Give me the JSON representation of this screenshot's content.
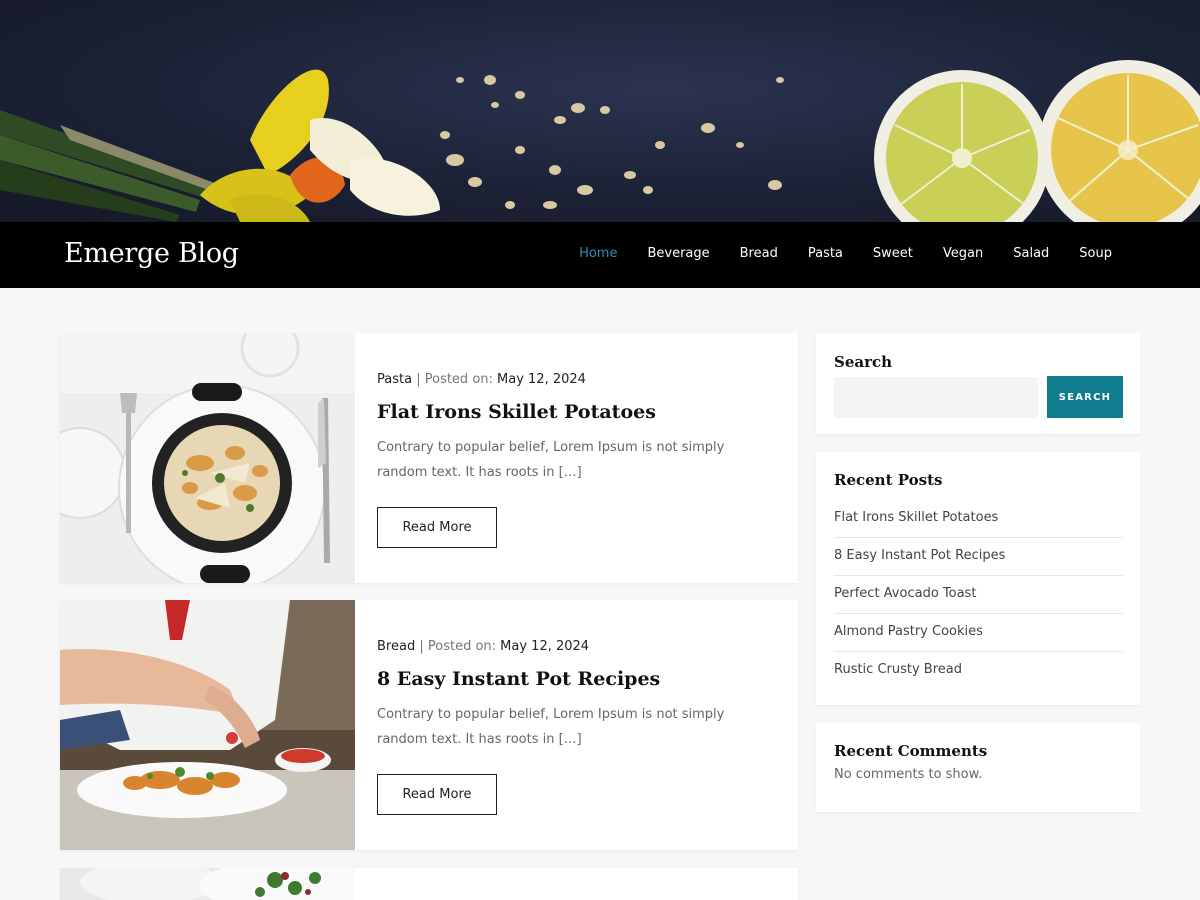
{
  "site": {
    "title": "Emerge Blog"
  },
  "nav": {
    "items": [
      {
        "label": "Home",
        "active": true
      },
      {
        "label": "Beverage",
        "active": false
      },
      {
        "label": "Bread",
        "active": false
      },
      {
        "label": "Pasta",
        "active": false
      },
      {
        "label": "Sweet",
        "active": false
      },
      {
        "label": "Vegan",
        "active": false
      },
      {
        "label": "Salad",
        "active": false
      },
      {
        "label": "Soup",
        "active": false
      }
    ]
  },
  "posts": [
    {
      "category": "Pasta",
      "separator": "|",
      "posted_on_label": "Posted on:",
      "date": "May 12, 2024",
      "title": "Flat Irons Skillet Potatoes",
      "excerpt": "Contrary to popular belief, Lorem Ipsum is not simply random text. It has roots in […]",
      "read_more": "Read More"
    },
    {
      "category": "Bread",
      "separator": "|",
      "posted_on_label": "Posted on:",
      "date": "May 12, 2024",
      "title": "8 Easy Instant Pot Recipes",
      "excerpt": "Contrary to popular belief, Lorem Ipsum is not simply random text. It has roots in […]",
      "read_more": "Read More"
    }
  ],
  "sidebar": {
    "search": {
      "title": "Search",
      "placeholder": "",
      "button_label": "SEARCH"
    },
    "recent_posts": {
      "title": "Recent Posts",
      "items": [
        "Flat Irons Skillet Potatoes",
        "8 Easy Instant Pot Recipes",
        "Perfect Avocado Toast",
        "Almond Pastry Cookies",
        "Rustic Crusty Bread"
      ]
    },
    "recent_comments": {
      "title": "Recent Comments",
      "empty_text": "No comments to show."
    }
  },
  "colors": {
    "nav_active": "#2a8fbf",
    "search_button": "#0f7d8e",
    "navbar_bg": "#000000"
  }
}
